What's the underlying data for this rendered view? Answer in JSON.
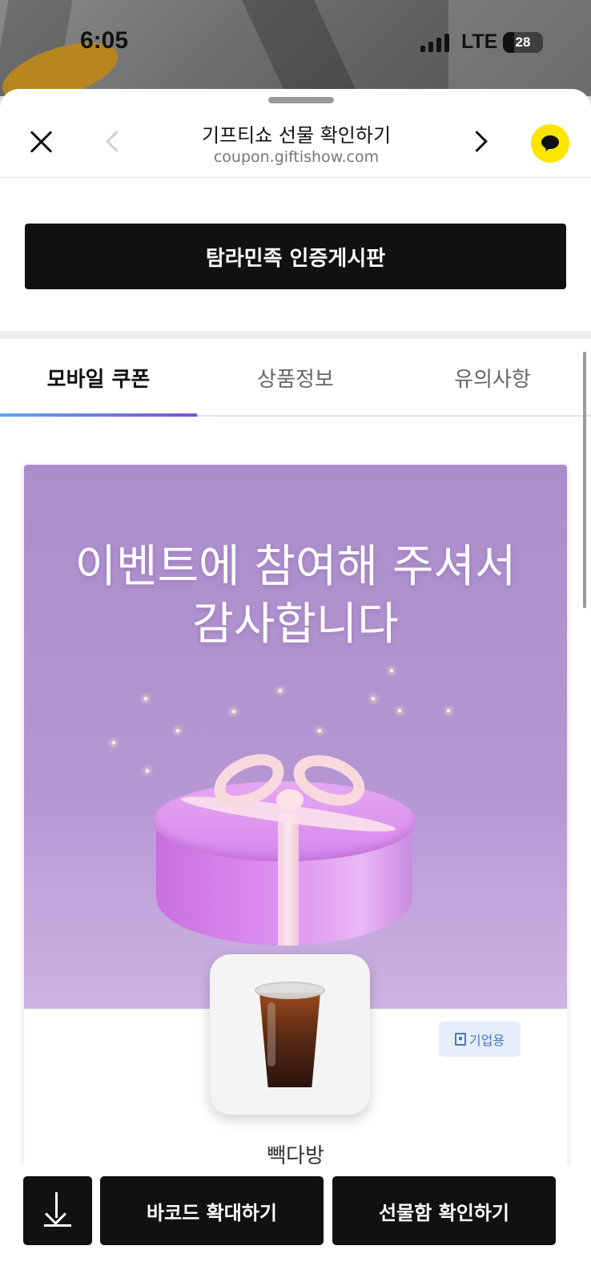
{
  "status_bar": {
    "time": "6:05",
    "network": "LTE",
    "battery": "28"
  },
  "navbar": {
    "title": "기프티쇼 선물 확인하기",
    "url": "coupon.giftishow.com"
  },
  "board_button": {
    "label": "탐라민족 인증게시판"
  },
  "tabs": [
    {
      "label": "모바일 쿠폰",
      "active": true
    },
    {
      "label": "상품정보",
      "active": false
    },
    {
      "label": "유의사항",
      "active": false
    }
  ],
  "banner": {
    "line1": "이벤트에 참여해 주셔서",
    "line2": "감사합니다"
  },
  "product": {
    "badge": "기업용",
    "brand": "빽다방"
  },
  "bottom_bar": {
    "barcode_label": "바코드 확대하기",
    "giftbox_label": "선물함 확인하기"
  },
  "colors": {
    "accent_tab_start": "#5aa8f0",
    "accent_tab_end": "#7b4fd6",
    "banner_bg": "#ac8dcb",
    "kakao_yellow": "#fee500"
  }
}
